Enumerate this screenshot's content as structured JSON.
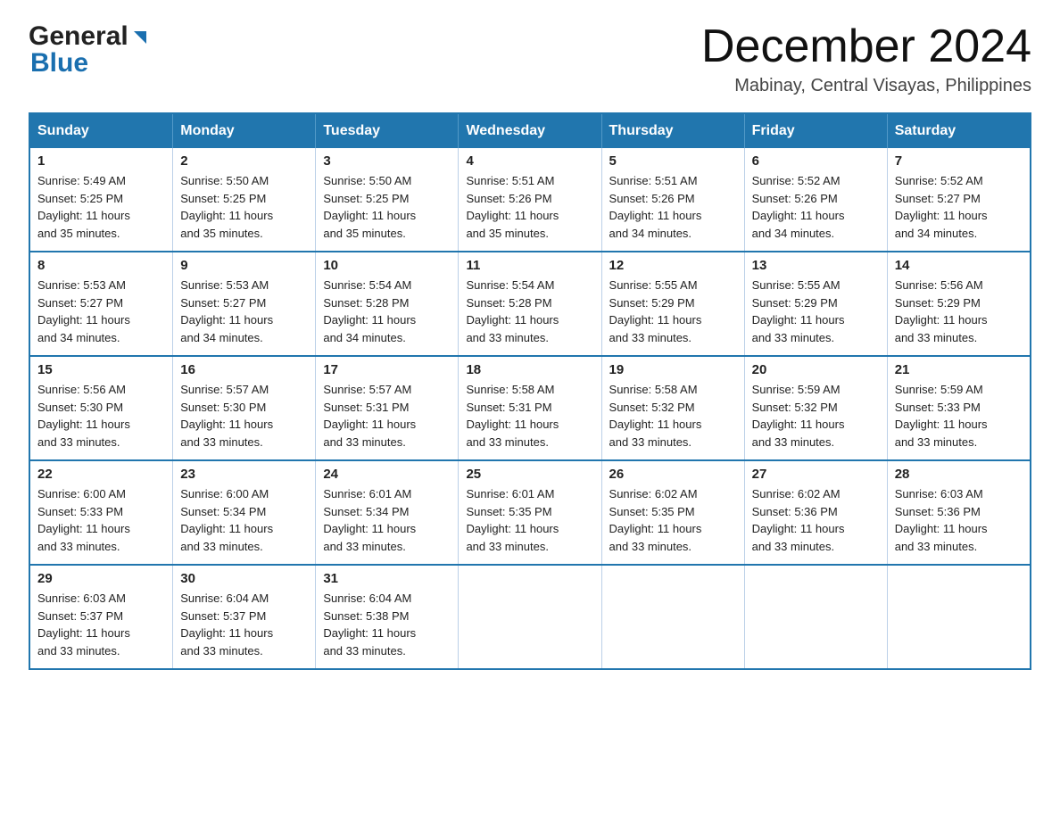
{
  "header": {
    "logo": {
      "general": "General",
      "blue": "Blue"
    },
    "month_year": "December 2024",
    "location": "Mabinay, Central Visayas, Philippines"
  },
  "days_of_week": [
    "Sunday",
    "Monday",
    "Tuesday",
    "Wednesday",
    "Thursday",
    "Friday",
    "Saturday"
  ],
  "weeks": [
    [
      {
        "day": 1,
        "sunrise": "5:49 AM",
        "sunset": "5:25 PM",
        "daylight": "11 hours and 35 minutes."
      },
      {
        "day": 2,
        "sunrise": "5:50 AM",
        "sunset": "5:25 PM",
        "daylight": "11 hours and 35 minutes."
      },
      {
        "day": 3,
        "sunrise": "5:50 AM",
        "sunset": "5:25 PM",
        "daylight": "11 hours and 35 minutes."
      },
      {
        "day": 4,
        "sunrise": "5:51 AM",
        "sunset": "5:26 PM",
        "daylight": "11 hours and 35 minutes."
      },
      {
        "day": 5,
        "sunrise": "5:51 AM",
        "sunset": "5:26 PM",
        "daylight": "11 hours and 34 minutes."
      },
      {
        "day": 6,
        "sunrise": "5:52 AM",
        "sunset": "5:26 PM",
        "daylight": "11 hours and 34 minutes."
      },
      {
        "day": 7,
        "sunrise": "5:52 AM",
        "sunset": "5:27 PM",
        "daylight": "11 hours and 34 minutes."
      }
    ],
    [
      {
        "day": 8,
        "sunrise": "5:53 AM",
        "sunset": "5:27 PM",
        "daylight": "11 hours and 34 minutes."
      },
      {
        "day": 9,
        "sunrise": "5:53 AM",
        "sunset": "5:27 PM",
        "daylight": "11 hours and 34 minutes."
      },
      {
        "day": 10,
        "sunrise": "5:54 AM",
        "sunset": "5:28 PM",
        "daylight": "11 hours and 34 minutes."
      },
      {
        "day": 11,
        "sunrise": "5:54 AM",
        "sunset": "5:28 PM",
        "daylight": "11 hours and 33 minutes."
      },
      {
        "day": 12,
        "sunrise": "5:55 AM",
        "sunset": "5:29 PM",
        "daylight": "11 hours and 33 minutes."
      },
      {
        "day": 13,
        "sunrise": "5:55 AM",
        "sunset": "5:29 PM",
        "daylight": "11 hours and 33 minutes."
      },
      {
        "day": 14,
        "sunrise": "5:56 AM",
        "sunset": "5:29 PM",
        "daylight": "11 hours and 33 minutes."
      }
    ],
    [
      {
        "day": 15,
        "sunrise": "5:56 AM",
        "sunset": "5:30 PM",
        "daylight": "11 hours and 33 minutes."
      },
      {
        "day": 16,
        "sunrise": "5:57 AM",
        "sunset": "5:30 PM",
        "daylight": "11 hours and 33 minutes."
      },
      {
        "day": 17,
        "sunrise": "5:57 AM",
        "sunset": "5:31 PM",
        "daylight": "11 hours and 33 minutes."
      },
      {
        "day": 18,
        "sunrise": "5:58 AM",
        "sunset": "5:31 PM",
        "daylight": "11 hours and 33 minutes."
      },
      {
        "day": 19,
        "sunrise": "5:58 AM",
        "sunset": "5:32 PM",
        "daylight": "11 hours and 33 minutes."
      },
      {
        "day": 20,
        "sunrise": "5:59 AM",
        "sunset": "5:32 PM",
        "daylight": "11 hours and 33 minutes."
      },
      {
        "day": 21,
        "sunrise": "5:59 AM",
        "sunset": "5:33 PM",
        "daylight": "11 hours and 33 minutes."
      }
    ],
    [
      {
        "day": 22,
        "sunrise": "6:00 AM",
        "sunset": "5:33 PM",
        "daylight": "11 hours and 33 minutes."
      },
      {
        "day": 23,
        "sunrise": "6:00 AM",
        "sunset": "5:34 PM",
        "daylight": "11 hours and 33 minutes."
      },
      {
        "day": 24,
        "sunrise": "6:01 AM",
        "sunset": "5:34 PM",
        "daylight": "11 hours and 33 minutes."
      },
      {
        "day": 25,
        "sunrise": "6:01 AM",
        "sunset": "5:35 PM",
        "daylight": "11 hours and 33 minutes."
      },
      {
        "day": 26,
        "sunrise": "6:02 AM",
        "sunset": "5:35 PM",
        "daylight": "11 hours and 33 minutes."
      },
      {
        "day": 27,
        "sunrise": "6:02 AM",
        "sunset": "5:36 PM",
        "daylight": "11 hours and 33 minutes."
      },
      {
        "day": 28,
        "sunrise": "6:03 AM",
        "sunset": "5:36 PM",
        "daylight": "11 hours and 33 minutes."
      }
    ],
    [
      {
        "day": 29,
        "sunrise": "6:03 AM",
        "sunset": "5:37 PM",
        "daylight": "11 hours and 33 minutes."
      },
      {
        "day": 30,
        "sunrise": "6:04 AM",
        "sunset": "5:37 PM",
        "daylight": "11 hours and 33 minutes."
      },
      {
        "day": 31,
        "sunrise": "6:04 AM",
        "sunset": "5:38 PM",
        "daylight": "11 hours and 33 minutes."
      },
      null,
      null,
      null,
      null
    ]
  ],
  "labels": {
    "sunrise": "Sunrise:",
    "sunset": "Sunset:",
    "daylight": "Daylight:"
  }
}
